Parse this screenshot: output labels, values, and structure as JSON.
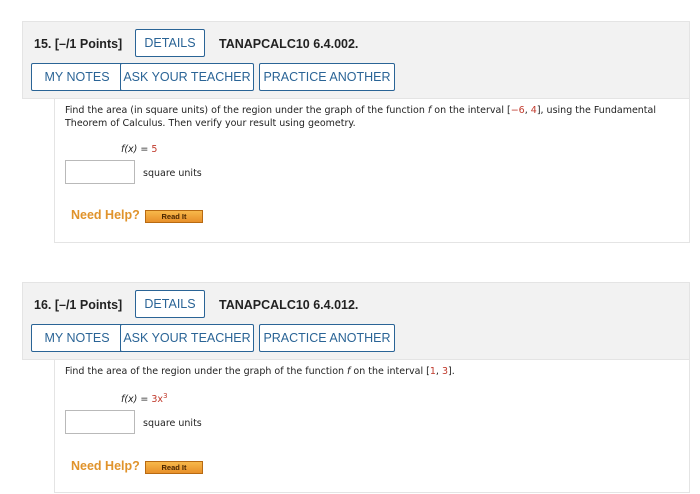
{
  "colors": {
    "accent": "#2a6496",
    "help": "#e0932b",
    "math_red": "#c0392b"
  },
  "questions": [
    {
      "number": "15. [–/1 Points]",
      "details_label": "DETAILS",
      "code": "TANAPCALC10 6.4.002.",
      "my_notes_label": "MY NOTES",
      "ask_teacher_label": "ASK YOUR TEACHER",
      "practice_label": "PRACTICE ANOTHER",
      "prompt_parts": [
        "Find the area (in square units) of the region under the graph of the function ",
        "f",
        " on the interval [",
        "−6",
        ", ",
        "4",
        "], using the Fundamental Theorem of Calculus. Then verify your result using geometry."
      ],
      "function_lhs": "f(x) = ",
      "function_rhs": "5",
      "function_exp": "",
      "answer_value": "",
      "units": "square units",
      "need_help": "Need Help?",
      "read_it": "Read It"
    },
    {
      "number": "16. [–/1 Points]",
      "details_label": "DETAILS",
      "code": "TANAPCALC10 6.4.012.",
      "my_notes_label": "MY NOTES",
      "ask_teacher_label": "ASK YOUR TEACHER",
      "practice_label": "PRACTICE ANOTHER",
      "prompt_parts": [
        "Find the area of the region under the graph of the function ",
        "f",
        " on the interval [",
        "1",
        ", ",
        "3",
        "]."
      ],
      "function_lhs": "f(x) = ",
      "function_rhs": "3x",
      "function_exp": "3",
      "answer_value": "",
      "units": "square units",
      "need_help": "Need Help?",
      "read_it": "Read It"
    }
  ]
}
